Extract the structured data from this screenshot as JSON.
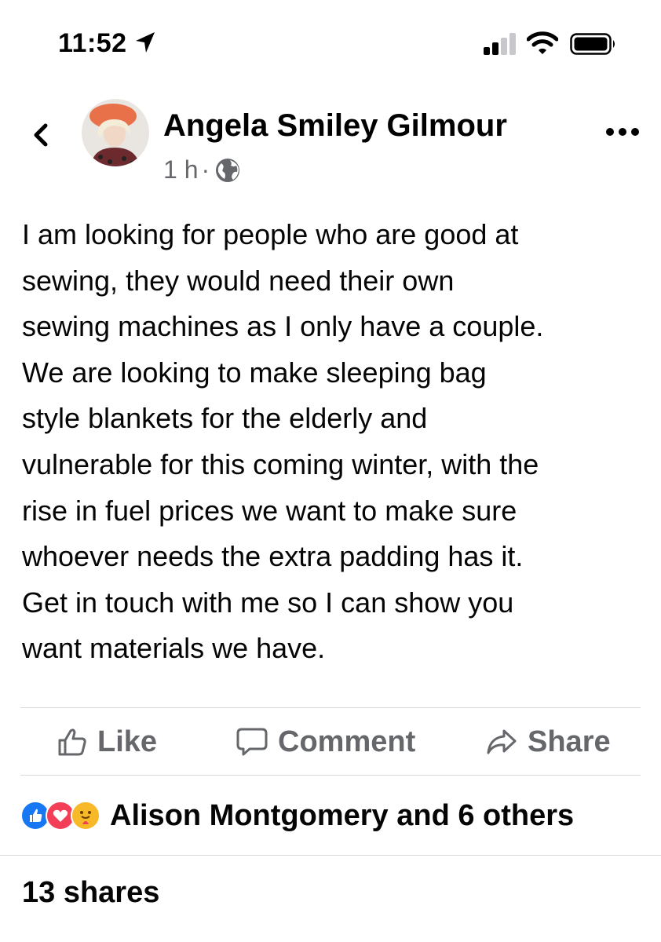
{
  "status_bar": {
    "time": "11:52",
    "icons": [
      "location-arrow-icon",
      "signal-bars-icon",
      "wifi-icon",
      "battery-icon"
    ]
  },
  "post": {
    "author": "Angela Smiley Gilmour",
    "time_ago": "1 h",
    "separator": "·",
    "privacy_icon": "globe-icon",
    "text_lines": [
      "I am looking for people who are good at",
      "sewing, they would need their own",
      "sewing machines as I only have a couple.",
      "We are looking to make sleeping bag",
      "style blankets for the elderly and",
      "vulnerable for this coming winter, with the",
      "rise in fuel prices we want to make sure",
      "whoever needs the extra padding has it.",
      "Get in touch with me so I can show you",
      "want materials we have."
    ]
  },
  "actions": {
    "like": "Like",
    "comment": "Comment",
    "share": "Share"
  },
  "reactions": {
    "icons": [
      "like-reaction-icon",
      "love-reaction-icon",
      "care-reaction-icon"
    ],
    "text": "Alison Montgomery and 6 others"
  },
  "shares": "13 shares",
  "colors": {
    "secondary_text": "#65676b",
    "like_blue": "#1877f2",
    "love_red": "#f33e58",
    "care_yellow": "#f7b928",
    "divider": "#d9dadc"
  }
}
